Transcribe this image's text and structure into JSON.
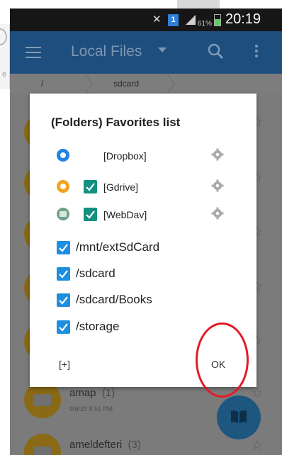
{
  "status_bar": {
    "battery_percent": "61%",
    "time": "20:19",
    "sim_label": "1"
  },
  "left_fragment": {
    "text": "e"
  },
  "app_bar": {
    "title": "Local Files",
    "icons": [
      "menu-icon",
      "dropdown-caret-icon",
      "search-icon",
      "more-vert-icon"
    ]
  },
  "breadcrumb": {
    "items": [
      "/",
      "sdcard"
    ]
  },
  "background_list": {
    "items": [
      {
        "name": "amap",
        "count": "(1)",
        "date": "9/6/20 9:51 PM"
      },
      {
        "name": "ameldefteri",
        "count": "(3)"
      }
    ]
  },
  "dialog": {
    "title": "(Folders) Favorites list",
    "services": [
      {
        "label": "[Dropbox]",
        "icon": "dropbox-icon",
        "checked": false
      },
      {
        "label": "[Gdrive]",
        "icon": "gdrive-icon",
        "checked": true
      },
      {
        "label": "[WebDav]",
        "icon": "webdav-icon",
        "checked": true
      }
    ],
    "paths": [
      {
        "label": "/mnt/extSdCard",
        "checked": true
      },
      {
        "label": "/sdcard",
        "checked": true
      },
      {
        "label": "/sdcard/Books",
        "checked": true
      },
      {
        "label": "/storage",
        "checked": true
      }
    ],
    "add_label": "[+]",
    "ok_label": "OK"
  },
  "colors": {
    "app_bar": "#1e4e7d",
    "checkbox_blue": "#1e8fe0",
    "checkbox_teal": "#129080",
    "annotation_red": "#e21c25",
    "folder_accent": "#8a6a14"
  }
}
